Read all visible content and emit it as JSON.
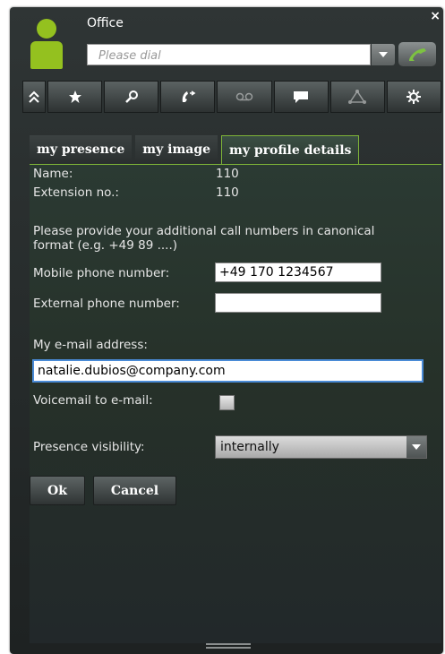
{
  "window": {
    "title": "Office",
    "close_label": "×"
  },
  "dial": {
    "placeholder": "Please dial"
  },
  "toolbar": {
    "buttons": [
      {
        "name": "collapse",
        "icon": "double-chevron-up-icon"
      },
      {
        "name": "favorites",
        "icon": "star-icon"
      },
      {
        "name": "search",
        "icon": "search-icon"
      },
      {
        "name": "call-forwarding",
        "icon": "forward-call-icon"
      },
      {
        "name": "voicemail",
        "icon": "voicemail-icon"
      },
      {
        "name": "chat",
        "icon": "chat-bubble-icon"
      },
      {
        "name": "conference",
        "icon": "network-icon"
      },
      {
        "name": "settings",
        "icon": "gear-icon"
      }
    ]
  },
  "tabs": [
    {
      "label": "my presence",
      "active": false
    },
    {
      "label": "my image",
      "active": false
    },
    {
      "label": "my profile details",
      "active": true
    }
  ],
  "profile": {
    "name_label": "Name:",
    "name_value": "110",
    "extension_label": "Extension no.:",
    "extension_value": "110",
    "info_text": "Please provide your additional call numbers in canonical format (e.g. +49 89 ....)",
    "mobile_label": "Mobile phone number:",
    "mobile_value": "+49 170 1234567",
    "external_label": "External phone number:",
    "external_value": "",
    "email_label": "My e-mail address:",
    "email_value": "natalie.dubios@company.com",
    "voicemail_label": "Voicemail to e-mail:",
    "voicemail_checked": false,
    "visibility_label": "Presence visibility:",
    "visibility_value": "internally"
  },
  "buttons": {
    "ok": "Ok",
    "cancel": "Cancel"
  },
  "colors": {
    "accent_green": "#94c11f",
    "tab_border": "#7fb538",
    "call_icon": "#7dc241"
  }
}
